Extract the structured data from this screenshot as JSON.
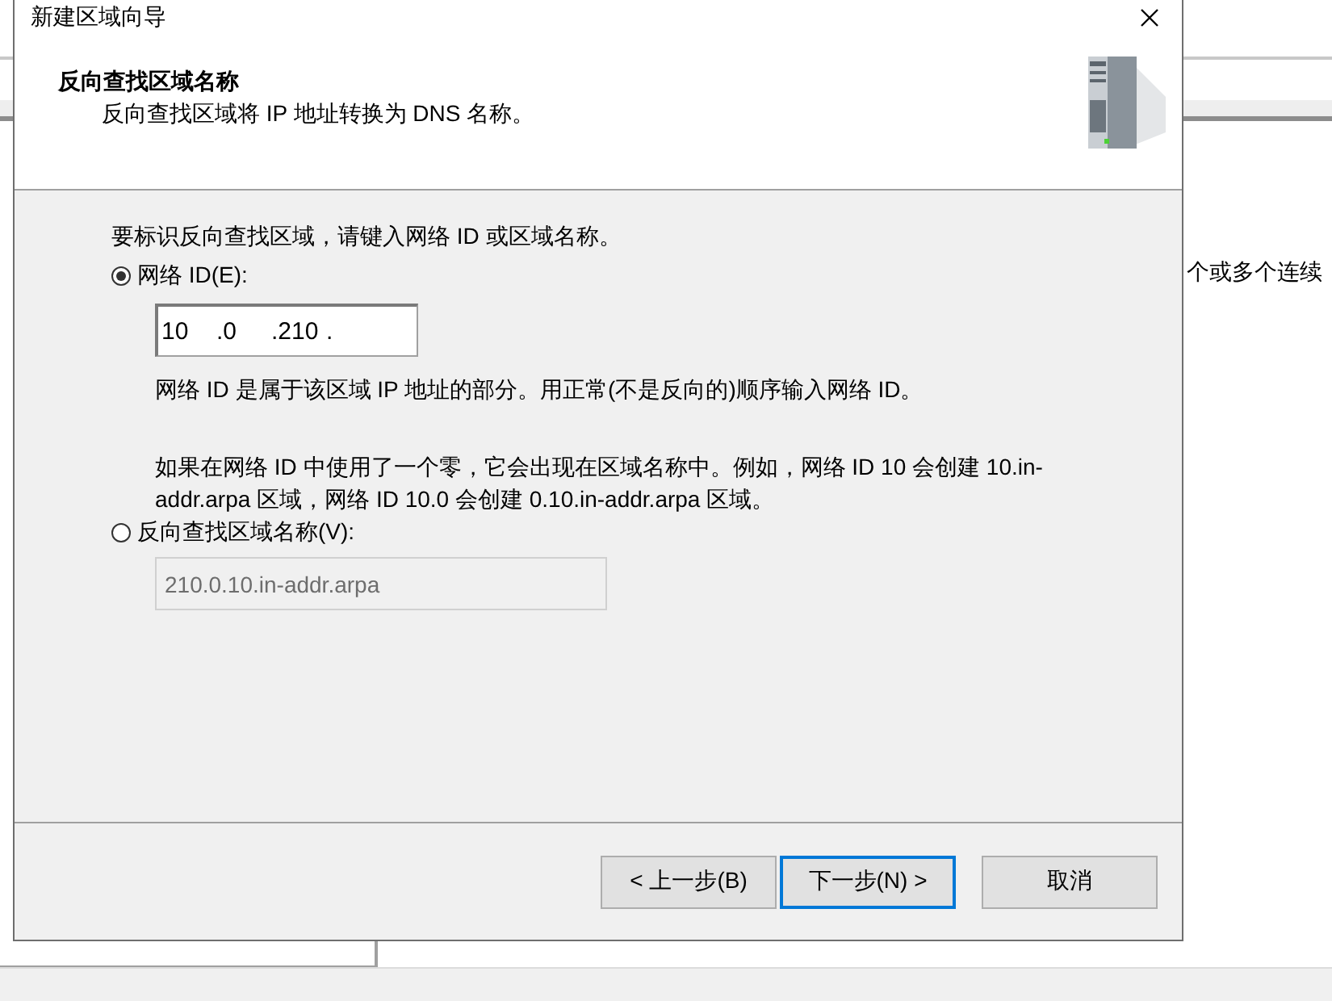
{
  "background_window": {
    "text": "个或多个连续"
  },
  "dialog": {
    "title": "新建区域向导",
    "header": {
      "title": "反向查找区域名称",
      "subtitle": "反向查找区域将 IP 地址转换为 DNS 名称。"
    },
    "intro": "要标识反向查找区域，请键入网络 ID 或区域名称。",
    "options": [
      {
        "kind": "ip",
        "label": "网络 ID(E):",
        "selected": true,
        "octets": [
          "10",
          ".0",
          ".210",
          "."
        ],
        "notes": [
          "网络 ID 是属于该区域 IP 地址的部分。用正常(不是反向的)顺序输入网络 ID。",
          "如果在网络 ID 中使用了一个零，它会出现在区域名称中。例如，网络 ID 10 会创建 10.in-addr.arpa 区域，网络 ID 10.0 会创建 0.10.in-addr.arpa 区域。"
        ]
      },
      {
        "kind": "name",
        "label": "反向查找区域名称(V):",
        "selected": false,
        "value": "210.0.10.in-addr.arpa",
        "disabled": true
      }
    ],
    "buttons": [
      {
        "label": "< 上一步(B)",
        "focused": false
      },
      {
        "label": "下一步(N) >",
        "focused": true
      },
      {
        "label": "取消",
        "focused": false
      }
    ]
  }
}
